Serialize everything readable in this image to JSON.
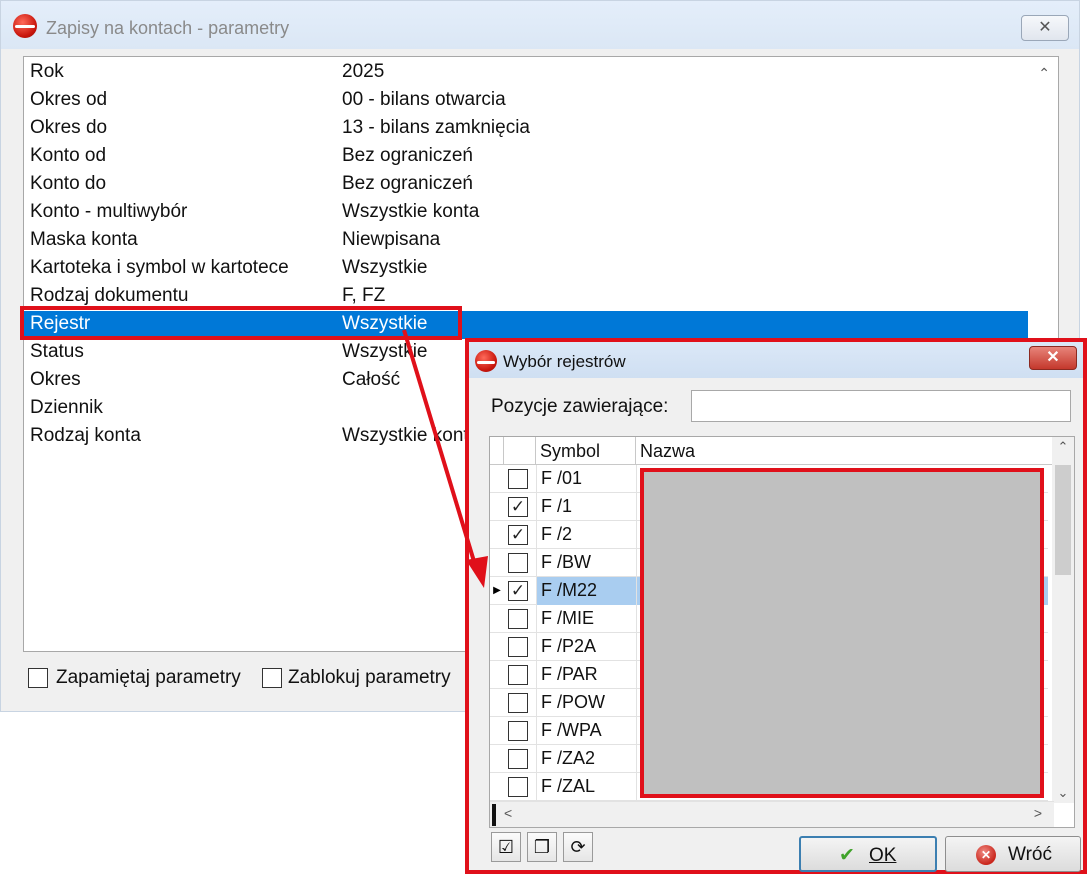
{
  "main_window": {
    "title": "Zapisy na kontach - parametry",
    "close_symbol": "✕",
    "scroll_up": "⌃",
    "params": [
      {
        "name": "Rok",
        "value": "2025"
      },
      {
        "name": "Okres od",
        "value": "00 - bilans otwarcia"
      },
      {
        "name": "Okres do",
        "value": "13 - bilans zamknięcia"
      },
      {
        "name": "Konto od",
        "value": "Bez ograniczeń"
      },
      {
        "name": "Konto do",
        "value": "Bez ograniczeń"
      },
      {
        "name": "Konto - multiwybór",
        "value": "Wszystkie konta"
      },
      {
        "name": "Maska konta",
        "value": "Niewpisana"
      },
      {
        "name": "Kartoteka i symbol w kartotece",
        "value": "Wszystkie"
      },
      {
        "name": "Rodzaj dokumentu",
        "value": "F, FZ"
      },
      {
        "name": "Rejestr",
        "value": "Wszystkie"
      },
      {
        "name": "Status",
        "value": "Wszystkie"
      },
      {
        "name": "Okres",
        "value": "Całość"
      },
      {
        "name": "Dziennik",
        "value": ""
      },
      {
        "name": "Rodzaj konta",
        "value": "Wszystkie konta"
      }
    ],
    "selected_index": 9,
    "remember_label": "Zapamiętaj parametry",
    "lock_label": "Zablokuj parametry"
  },
  "dialog": {
    "title": "Wybór rejestrów",
    "close_symbol": "✕",
    "filter_label": "Pozycje zawierające:",
    "filter_value": "",
    "columns": {
      "symbol": "Symbol",
      "name": "Nazwa"
    },
    "rows": [
      {
        "symbol": "F /01",
        "checked": false
      },
      {
        "symbol": "F /1",
        "checked": true
      },
      {
        "symbol": "F /2",
        "checked": true
      },
      {
        "symbol": "F /BW",
        "checked": false
      },
      {
        "symbol": "F /M22",
        "checked": true
      },
      {
        "symbol": "F /MIE",
        "checked": false
      },
      {
        "symbol": "F /P2A",
        "checked": false
      },
      {
        "symbol": "F /PAR",
        "checked": false
      },
      {
        "symbol": "F /POW",
        "checked": false
      },
      {
        "symbol": "F /WPA",
        "checked": false
      },
      {
        "symbol": "F /ZA2",
        "checked": false
      },
      {
        "symbol": "F /ZAL",
        "checked": false
      }
    ],
    "current_row": 4,
    "current_marker": "▶",
    "check_mark": "✓",
    "scroll_up": "⌃",
    "scroll_down": "⌄",
    "scroll_left": "<",
    "scroll_right": ">",
    "tools": {
      "select_all": "☑",
      "deselect_all": "❐",
      "invert": "⟳"
    },
    "ok_icon": "✔",
    "ok_label": "OK",
    "back_icon": "✕",
    "back_label": "Wróć"
  },
  "colors": {
    "selection": "#0078d7",
    "highlight": "#e0101a",
    "current_row": "#a9cdf0"
  }
}
